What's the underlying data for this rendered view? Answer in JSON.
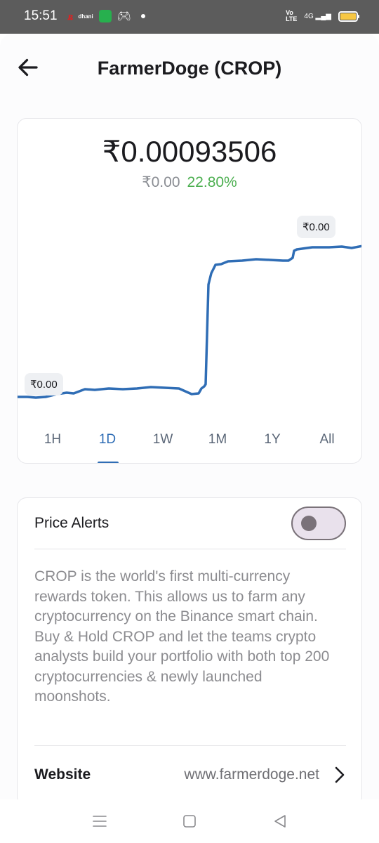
{
  "status_bar": {
    "time": "15:51",
    "notification_icons": [
      "r-app-icon",
      "dhani-icon",
      "green-app-icon",
      "gamepad-icon",
      "dot-icon"
    ],
    "dhani_label": "dhani",
    "volte_line1": "Vo",
    "volte_line2": "LTE",
    "network": "4G",
    "battery_color": "#f6c744"
  },
  "header": {
    "title": "FarmerDoge (CROP)"
  },
  "price_card": {
    "price": "₹0.00093506",
    "change": "₹0.00",
    "change_percent": "22.80%",
    "change_color": "#4caf50",
    "line_color": "#2f6db5",
    "high_label": "₹0.00",
    "low_label": "₹0.00",
    "tabs": [
      {
        "label": "1H",
        "active": false
      },
      {
        "label": "1D",
        "active": true
      },
      {
        "label": "1W",
        "active": false
      },
      {
        "label": "1M",
        "active": false
      },
      {
        "label": "1Y",
        "active": false
      },
      {
        "label": "All",
        "active": false
      }
    ]
  },
  "info_card": {
    "alerts_label": "Price Alerts",
    "alerts_enabled": false,
    "description": "CROP is the world's first multi-currency rewards token. This allows us to farm any cryptocurrency on the Binance smart chain. Buy & Hold CROP and let the teams crypto analysts build your portfolio with both top 200 cryptocurrencies & newly launched moonshots.",
    "website_label": "Website",
    "website_url": "www.farmerdoge.net"
  },
  "nav_bar": {
    "buttons": [
      "menu-icon",
      "home-square-icon",
      "back-triangle-icon"
    ]
  }
}
